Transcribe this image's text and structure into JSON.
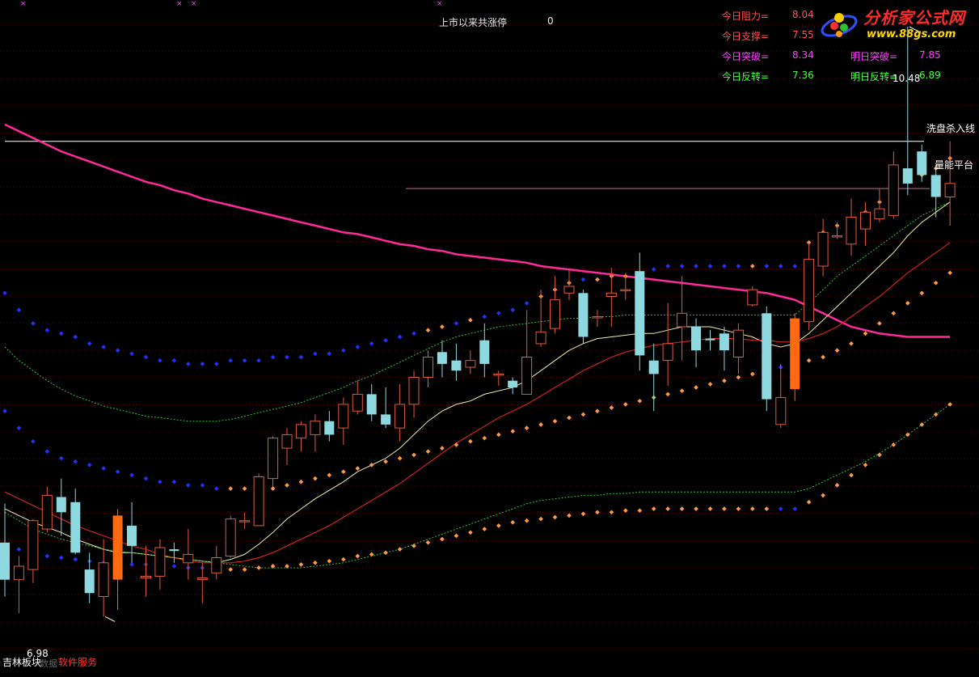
{
  "header": {
    "limit_up_label": "上市以来共涨停",
    "limit_up_value": "0"
  },
  "indicators": [
    {
      "label": "今日阻力=",
      "value": "8.04",
      "label_color": "#ff5050",
      "value_color": "#ff5050"
    },
    {
      "label": "今日支撑=",
      "value": "7.55",
      "label_color": "#ff5050",
      "value_color": "#ff5050"
    },
    {
      "label": "今日突破=",
      "value": "8.34",
      "label_color": "#ff40ff",
      "value_color": "#ff40ff"
    },
    {
      "label": "明日突破=",
      "value": "7.85",
      "label_color": "#ff40ff",
      "value_color": "#ff40ff"
    },
    {
      "label": "今日反转=",
      "value": "7.36",
      "label_color": "#40ff40",
      "value_color": "#40ff40"
    },
    {
      "label": "明日反转=",
      "value": "6.89",
      "label_color": "#40ff40",
      "value_color": "#40ff40"
    }
  ],
  "logo": {
    "title": "分析家公式网",
    "url": "www.88gs.com"
  },
  "footer": {
    "block_label": "吉林板块",
    "service_label": "软件服务",
    "faint_label": "数据"
  },
  "chart_data": {
    "type": "candlestick",
    "ylim": [
      6.8,
      10.6
    ],
    "max_label": "10.48",
    "min_label": "6.98",
    "max_value": 10.48,
    "min_value": 6.98,
    "hlines": [
      {
        "name": "洗盘杀入线",
        "value": 9.8,
        "color": "#ffffff"
      },
      {
        "name": "量能平台",
        "value": 9.52,
        "color": "#c07090"
      }
    ],
    "candles": [
      [
        7.42,
        7.2,
        7.65,
        7.1
      ],
      [
        7.2,
        7.28,
        7.34,
        7.0
      ],
      [
        7.26,
        7.55,
        7.56,
        7.18
      ],
      [
        7.5,
        7.7,
        7.75,
        7.48
      ],
      [
        7.69,
        7.6,
        7.8,
        7.46
      ],
      [
        7.66,
        7.36,
        7.74,
        7.35
      ],
      [
        7.26,
        7.12,
        7.36,
        7.06
      ],
      [
        7.1,
        7.3,
        7.44,
        6.98
      ],
      [
        7.2,
        7.58,
        7.62,
        7.02
      ],
      [
        7.52,
        7.4,
        7.66,
        7.3
      ],
      [
        7.21,
        7.22,
        7.4,
        7.1
      ],
      [
        7.22,
        7.39,
        7.44,
        7.14
      ],
      [
        7.38,
        7.37,
        7.42,
        7.3
      ],
      [
        7.3,
        7.35,
        7.5,
        7.2
      ],
      [
        7.2,
        7.21,
        7.3,
        7.06
      ],
      [
        7.24,
        7.33,
        7.4,
        7.2
      ],
      [
        7.34,
        7.56,
        7.58,
        7.33
      ],
      [
        7.55,
        7.55,
        7.6,
        7.5
      ],
      [
        7.52,
        7.81,
        7.83,
        7.52
      ],
      [
        7.8,
        8.04,
        8.05,
        7.75
      ],
      [
        7.98,
        8.06,
        8.1,
        7.88
      ],
      [
        8.04,
        8.12,
        8.14,
        7.96
      ],
      [
        8.06,
        8.14,
        8.18,
        7.96
      ],
      [
        8.14,
        8.06,
        8.2,
        8.02
      ],
      [
        8.1,
        8.24,
        8.28,
        8.0
      ],
      [
        8.2,
        8.3,
        8.38,
        8.18
      ],
      [
        8.3,
        8.18,
        8.36,
        8.14
      ],
      [
        8.18,
        8.12,
        8.34,
        8.1
      ],
      [
        8.1,
        8.24,
        8.36,
        8.02
      ],
      [
        8.24,
        8.4,
        8.44,
        8.16
      ],
      [
        8.4,
        8.52,
        8.56,
        8.34
      ],
      [
        8.55,
        8.48,
        8.62,
        8.4
      ],
      [
        8.5,
        8.44,
        8.6,
        8.38
      ],
      [
        8.46,
        8.5,
        8.56,
        8.42
      ],
      [
        8.62,
        8.48,
        8.72,
        8.4
      ],
      [
        8.42,
        8.42,
        8.44,
        8.35
      ],
      [
        8.38,
        8.34,
        8.4,
        8.3
      ],
      [
        8.3,
        8.52,
        8.8,
        8.3
      ],
      [
        8.6,
        8.67,
        8.92,
        8.58
      ],
      [
        8.69,
        8.86,
        9.0,
        8.66
      ],
      [
        8.9,
        8.94,
        9.04,
        8.86
      ],
      [
        8.9,
        8.64,
        8.92,
        8.6
      ],
      [
        8.76,
        8.76,
        8.8,
        8.7
      ],
      [
        8.88,
        8.9,
        9.05,
        8.7
      ],
      [
        8.92,
        8.92,
        9.02,
        8.86
      ],
      [
        9.03,
        8.53,
        9.14,
        8.44
      ],
      [
        8.5,
        8.42,
        8.6,
        8.2
      ],
      [
        8.5,
        8.6,
        8.84,
        8.35
      ],
      [
        8.7,
        8.78,
        9.0,
        8.5
      ],
      [
        8.7,
        8.56,
        8.75,
        8.46
      ],
      [
        8.63,
        8.62,
        8.68,
        8.56
      ],
      [
        8.66,
        8.56,
        8.7,
        8.44
      ],
      [
        8.52,
        8.68,
        8.72,
        8.42
      ],
      [
        8.83,
        8.92,
        8.94,
        8.82
      ],
      [
        8.78,
        8.27,
        8.82,
        8.2
      ],
      [
        8.12,
        8.28,
        8.48,
        8.1
      ],
      [
        8.33,
        8.75,
        8.78,
        8.26
      ],
      [
        8.73,
        9.1,
        9.2,
        8.68
      ],
      [
        9.06,
        9.26,
        9.34,
        9.0
      ],
      [
        9.24,
        9.24,
        9.32,
        9.22
      ],
      [
        9.19,
        9.35,
        9.46,
        9.12
      ],
      [
        9.28,
        9.38,
        9.44,
        9.18
      ],
      [
        9.34,
        9.4,
        9.52,
        9.32
      ],
      [
        9.36,
        9.66,
        9.74,
        9.34
      ],
      [
        9.64,
        9.55,
        10.48,
        9.48
      ],
      [
        9.74,
        9.6,
        9.78,
        9.56
      ],
      [
        9.6,
        9.47,
        9.66,
        9.35
      ],
      [
        9.47,
        9.55,
        9.8,
        9.3
      ]
    ],
    "candle_colors": {
      "up": "#e05a3a",
      "down": "#8ed8e0",
      "big_up": "#ff6a10",
      "big_up_index": [
        8,
        56
      ]
    },
    "series": [
      {
        "values": [
          9.9,
          9.86,
          9.82,
          9.78,
          9.74,
          9.71,
          9.68,
          9.65,
          9.62,
          9.59,
          9.56,
          9.54,
          9.51,
          9.49,
          9.46,
          9.44,
          9.42,
          9.4,
          9.38,
          9.36,
          9.34,
          9.32,
          9.3,
          9.28,
          9.26,
          9.25,
          9.23,
          9.21,
          9.19,
          9.18,
          9.16,
          9.15,
          9.13,
          9.12,
          9.11,
          9.1,
          9.09,
          9.08,
          9.06,
          9.05,
          9.04,
          9.03,
          9.02,
          9.01,
          9.0,
          8.99,
          8.98,
          8.97,
          8.96,
          8.95,
          8.94,
          8.93,
          8.92,
          8.91,
          8.9,
          8.88,
          8.86,
          8.82,
          8.78,
          8.74,
          8.7,
          8.68,
          8.66,
          8.65,
          8.64,
          8.64,
          8.64,
          8.64
        ],
        "color": "#ff2a9a",
        "width": 2.5,
        "start": 0
      },
      {
        "values": [
          7.62,
          7.58,
          7.54,
          7.51,
          7.48,
          7.44,
          7.41,
          7.38,
          7.36,
          7.36,
          7.35,
          7.34,
          7.33,
          7.32,
          7.31,
          7.3,
          7.32,
          7.35,
          7.41,
          7.48,
          7.56,
          7.62,
          7.68,
          7.73,
          7.78,
          7.84,
          7.88,
          7.92,
          7.98,
          8.06,
          8.14,
          8.2,
          8.24,
          8.26,
          8.3,
          8.32,
          8.34,
          8.38,
          8.44,
          8.5,
          8.56,
          8.6,
          8.63,
          8.64,
          8.65,
          8.66,
          8.66,
          8.68,
          8.7,
          8.7,
          8.7,
          8.68,
          8.66,
          8.64,
          8.6,
          8.58,
          8.6,
          8.66,
          8.74,
          8.82,
          8.9,
          8.98,
          9.06,
          9.14,
          9.24,
          9.32,
          9.38,
          9.44
        ],
        "color": "#f0f0a8",
        "width": 1,
        "start": 0
      },
      {
        "values": [
          7.72,
          7.68,
          7.64,
          7.6,
          7.56,
          7.52,
          7.49,
          7.46,
          7.43,
          7.4,
          7.38,
          7.35,
          7.33,
          7.31,
          7.3,
          7.3,
          7.3,
          7.31,
          7.33,
          7.36,
          7.4,
          7.44,
          7.48,
          7.52,
          7.57,
          7.62,
          7.67,
          7.72,
          7.77,
          7.83,
          7.89,
          7.95,
          8.01,
          8.06,
          8.11,
          8.16,
          8.2,
          8.24,
          8.29,
          8.34,
          8.39,
          8.44,
          8.48,
          8.52,
          8.55,
          8.57,
          8.59,
          8.6,
          8.61,
          8.62,
          8.63,
          8.63,
          8.63,
          8.62,
          8.62,
          8.61,
          8.61,
          8.63,
          8.66,
          8.7,
          8.76,
          8.82,
          8.88,
          8.95,
          9.02,
          9.08,
          9.14,
          9.2
        ],
        "color": "#d02020",
        "width": 1.2,
        "start": 0
      },
      {
        "values": [
          8.58,
          8.5,
          8.44,
          8.38,
          8.33,
          8.29,
          8.26,
          8.23,
          8.21,
          8.19,
          8.17,
          8.16,
          8.15,
          8.14,
          8.14,
          8.14,
          8.15,
          8.17,
          8.19,
          8.21,
          8.23,
          8.25,
          8.28,
          8.31,
          8.34,
          8.38,
          8.41,
          8.45,
          8.49,
          8.53,
          8.57,
          8.61,
          8.64,
          8.66,
          8.68,
          8.7,
          8.71,
          8.72,
          8.73,
          8.74,
          8.75,
          8.75,
          8.76,
          8.76,
          8.77,
          8.77,
          8.77,
          8.77,
          8.77,
          8.77,
          8.77,
          8.77,
          8.77,
          8.77,
          8.77,
          8.77,
          8.77,
          8.84,
          8.92,
          9.0,
          9.06,
          9.12,
          9.18,
          9.24,
          9.3,
          9.36,
          9.4,
          9.44
        ],
        "color": "#30c030",
        "width": 1,
        "dashed": true,
        "start": 0
      },
      {
        "values": [
          7.6,
          7.55,
          7.5,
          7.47,
          7.44,
          7.42,
          7.4,
          7.38,
          7.37,
          7.36,
          7.35,
          7.34,
          7.33,
          7.32,
          7.31,
          7.3,
          7.29,
          7.28,
          7.27,
          7.27,
          7.27,
          7.27,
          7.28,
          7.29,
          7.3,
          7.32,
          7.34,
          7.36,
          7.38,
          7.41,
          7.44,
          7.47,
          7.5,
          7.53,
          7.56,
          7.59,
          7.62,
          7.65,
          7.67,
          7.68,
          7.69,
          7.7,
          7.7,
          7.71,
          7.71,
          7.72,
          7.72,
          7.72,
          7.72,
          7.72,
          7.72,
          7.72,
          7.72,
          7.72,
          7.72,
          7.72,
          7.72,
          7.74,
          7.78,
          7.82,
          7.86,
          7.9,
          7.95,
          8.0,
          8.06,
          8.12,
          8.18,
          8.24
        ],
        "color": "#30c030",
        "width": 1,
        "dashed": true,
        "start": 0
      }
    ],
    "dots_upper": [
      8.9,
      8.8,
      8.72,
      8.68,
      8.66,
      8.64,
      8.6,
      8.58,
      8.56,
      8.54,
      8.52,
      8.5,
      8.5,
      8.48,
      8.48,
      8.48,
      8.5,
      8.5,
      8.5,
      8.52,
      8.52,
      8.52,
      8.54,
      8.54,
      8.56,
      8.58,
      8.6,
      8.62,
      8.64,
      8.66,
      8.68,
      8.7,
      8.72,
      8.74,
      8.76,
      8.78,
      8.8,
      8.84,
      8.88,
      8.92,
      8.96,
      8.98,
      8.98,
      9.0,
      9.0,
      9.0,
      9.04,
      9.06,
      9.06,
      9.06,
      9.06,
      9.06,
      9.06,
      9.06,
      9.06,
      9.06,
      9.06,
      9.2,
      9.26,
      9.3,
      9.34,
      9.38,
      9.44,
      9.5,
      9.56,
      9.6,
      9.64,
      9.7
    ],
    "dots_lower": [
      8.2,
      8.1,
      8.02,
      7.96,
      7.92,
      7.9,
      7.88,
      7.86,
      7.84,
      7.82,
      7.8,
      7.78,
      7.78,
      7.76,
      7.76,
      7.74,
      7.74,
      7.74,
      7.74,
      7.74,
      7.76,
      7.78,
      7.8,
      7.82,
      7.84,
      7.86,
      7.88,
      7.9,
      7.92,
      7.94,
      7.96,
      7.98,
      8.0,
      8.02,
      8.04,
      8.06,
      8.08,
      8.1,
      8.12,
      8.14,
      8.16,
      8.18,
      8.2,
      8.22,
      8.24,
      8.26,
      8.28,
      8.3,
      8.32,
      8.34,
      8.36,
      8.38,
      8.4,
      8.42,
      8.44,
      8.46,
      8.48,
      8.5,
      8.52,
      8.56,
      8.6,
      8.66,
      8.72,
      8.78,
      8.84,
      8.9,
      8.96,
      9.02
    ],
    "dots_bottom": [
      7.4,
      7.38,
      7.36,
      7.34,
      7.33,
      7.32,
      7.31,
      7.3,
      7.3,
      7.29,
      7.29,
      7.28,
      7.28,
      7.27,
      7.27,
      7.26,
      7.26,
      7.26,
      7.27,
      7.28,
      7.28,
      7.29,
      7.3,
      7.31,
      7.32,
      7.34,
      7.35,
      7.36,
      7.38,
      7.4,
      7.42,
      7.44,
      7.46,
      7.48,
      7.5,
      7.52,
      7.54,
      7.55,
      7.56,
      7.57,
      7.58,
      7.59,
      7.6,
      7.6,
      7.61,
      7.61,
      7.62,
      7.62,
      7.62,
      7.62,
      7.62,
      7.62,
      7.62,
      7.62,
      7.62,
      7.62,
      7.62,
      7.66,
      7.7,
      7.76,
      7.82,
      7.88,
      7.94,
      8.0,
      8.06,
      8.12,
      8.18,
      8.24
    ],
    "dot_colors": {
      "blue": "#2030ff",
      "orange": "#ff9a40"
    }
  }
}
